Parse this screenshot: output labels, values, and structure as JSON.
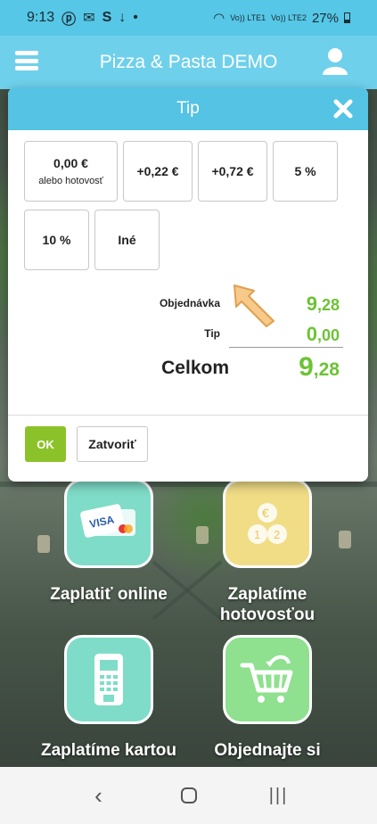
{
  "status_bar": {
    "time": "9:13",
    "indicators": [
      "pinterest-icon",
      "mail-icon",
      "s-icon",
      "download-icon",
      "dot"
    ],
    "lte1": "Vo)) LTE1",
    "lte2": "Vo)) LTE2",
    "battery": "27%"
  },
  "header": {
    "title": "Pizza & Pasta DEMO"
  },
  "modal": {
    "title": "Tip",
    "tip_options": [
      {
        "label": "0,00 €",
        "sub": "alebo hotovosť"
      },
      {
        "label": "+0,22 €"
      },
      {
        "label": "+0,72 €"
      },
      {
        "label": "5 %"
      },
      {
        "label": "10 %"
      },
      {
        "label": "Iné"
      }
    ],
    "order_label": "Objednávka",
    "order_value_int": "9",
    "order_value_dec": ",28",
    "tip_label": "Tip",
    "tip_value_int": "0",
    "tip_value_dec": ",00",
    "total_label": "Celkom",
    "total_value_int": "9",
    "total_value_dec": ",28",
    "ok_label": "OK",
    "close_label": "Zatvoriť"
  },
  "tiles": [
    {
      "label": "Zaplatiť online",
      "icon": "credit-card-icon",
      "color": "#7fdcc8"
    },
    {
      "label": "Zaplatíme hotovosťou",
      "icon": "coins-icon",
      "color": "#f0dd86"
    },
    {
      "label": "Zaplatíme kartou",
      "icon": "card-terminal-icon",
      "color": "#7fdcc8"
    },
    {
      "label": "Objednajte si",
      "icon": "cart-icon",
      "color": "#8fe08f"
    }
  ],
  "colors": {
    "accent": "#55c3e3",
    "value_green": "#6cc334",
    "ok_green": "#8bc229"
  }
}
